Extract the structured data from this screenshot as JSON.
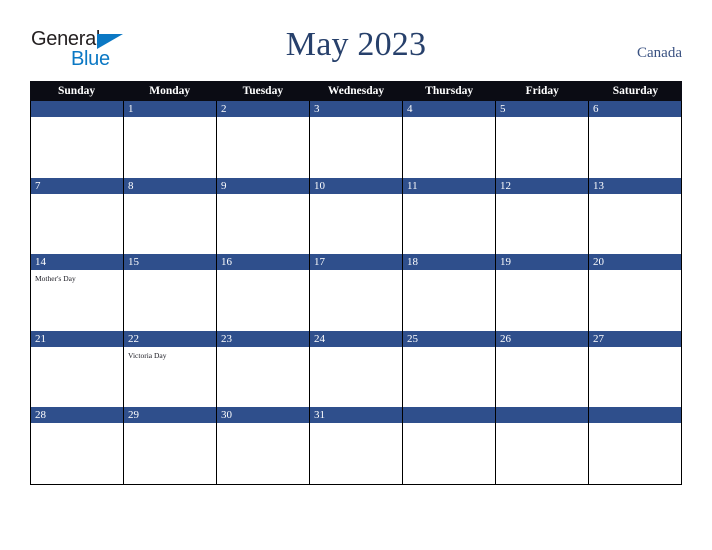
{
  "brand": {
    "name_part1": "General",
    "name_part2": "Blue",
    "triangle_icon": "triangle-icon",
    "color_dark": "#231f20",
    "color_blue": "#0b78c4"
  },
  "header": {
    "title": "May 2023",
    "country": "Canada",
    "title_color": "#27406b"
  },
  "calendar": {
    "month": "May",
    "year": "2023",
    "weekday_headers": [
      "Sunday",
      "Monday",
      "Tuesday",
      "Wednesday",
      "Thursday",
      "Friday",
      "Saturday"
    ],
    "header_bg": "#0b0c14",
    "daybar_bg": "#2f4f8c",
    "grid_border": "#000000",
    "weeks": [
      [
        {
          "date": "",
          "events": []
        },
        {
          "date": "1",
          "events": []
        },
        {
          "date": "2",
          "events": []
        },
        {
          "date": "3",
          "events": []
        },
        {
          "date": "4",
          "events": []
        },
        {
          "date": "5",
          "events": []
        },
        {
          "date": "6",
          "events": []
        }
      ],
      [
        {
          "date": "7",
          "events": []
        },
        {
          "date": "8",
          "events": []
        },
        {
          "date": "9",
          "events": []
        },
        {
          "date": "10",
          "events": []
        },
        {
          "date": "11",
          "events": []
        },
        {
          "date": "12",
          "events": []
        },
        {
          "date": "13",
          "events": []
        }
      ],
      [
        {
          "date": "14",
          "events": [
            "Mother's Day"
          ]
        },
        {
          "date": "15",
          "events": []
        },
        {
          "date": "16",
          "events": []
        },
        {
          "date": "17",
          "events": []
        },
        {
          "date": "18",
          "events": []
        },
        {
          "date": "19",
          "events": []
        },
        {
          "date": "20",
          "events": []
        }
      ],
      [
        {
          "date": "21",
          "events": []
        },
        {
          "date": "22",
          "events": [
            "Victoria Day"
          ]
        },
        {
          "date": "23",
          "events": []
        },
        {
          "date": "24",
          "events": []
        },
        {
          "date": "25",
          "events": []
        },
        {
          "date": "26",
          "events": []
        },
        {
          "date": "27",
          "events": []
        }
      ],
      [
        {
          "date": "28",
          "events": []
        },
        {
          "date": "29",
          "events": []
        },
        {
          "date": "30",
          "events": []
        },
        {
          "date": "31",
          "events": []
        },
        {
          "date": "",
          "events": []
        },
        {
          "date": "",
          "events": []
        },
        {
          "date": "",
          "events": []
        }
      ]
    ]
  }
}
